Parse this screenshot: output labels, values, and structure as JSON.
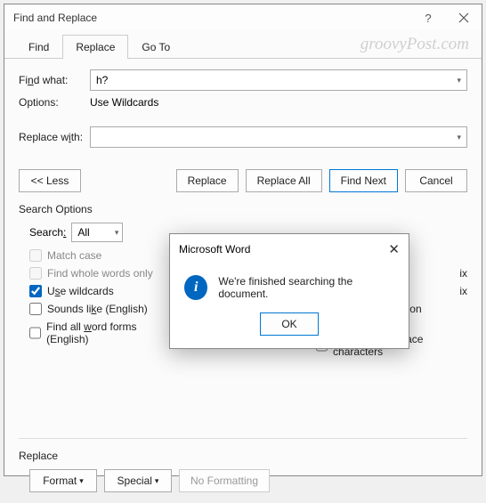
{
  "window": {
    "title": "Find and Replace"
  },
  "watermark": "groovyPost.com",
  "tabs": {
    "find": "Find",
    "replace": "Replace",
    "goto": "Go To",
    "active": "replace"
  },
  "fields": {
    "findwhat_label": "Find what:",
    "findwhat_value": "h?",
    "options_label": "Options:",
    "options_value": "Use Wildcards",
    "replacewith_label": "Replace with:",
    "replacewith_value": ""
  },
  "buttons": {
    "less": "<< Less",
    "replace": "Replace",
    "replace_all": "Replace All",
    "find_next": "Find Next",
    "cancel": "Cancel"
  },
  "search_options": {
    "heading": "Search Options",
    "search_label": "Search:",
    "search_value": "All",
    "match_case": "Match case",
    "whole_words": "Find whole words only",
    "use_wildcards": "Use wildcards",
    "sounds_like": "Sounds like (English)",
    "word_forms": "Find all word forms (English)",
    "match_prefix_suffix_hidden": "ix",
    "ignore_punct": "Ignore punctuation characters",
    "ignore_ws": "Ignore white-space characters"
  },
  "replace_section": {
    "heading": "Replace",
    "format": "Format",
    "special": "Special",
    "no_formatting": "No Formatting"
  },
  "modal": {
    "title": "Microsoft Word",
    "message": "We're finished searching the document.",
    "ok": "OK",
    "icon": "i"
  }
}
